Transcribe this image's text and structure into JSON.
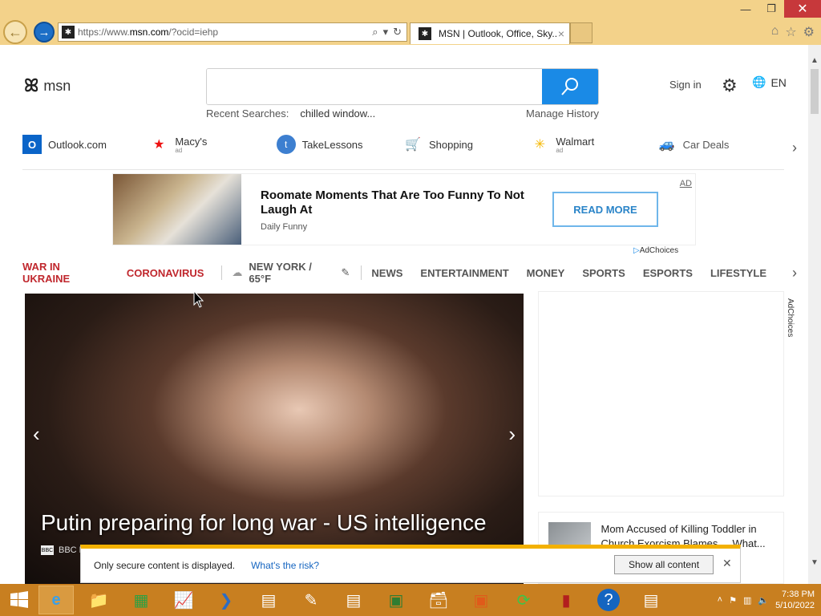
{
  "browser": {
    "url": "https://www.msn.com/?ocid=iehp",
    "url_prefix": "https://www.",
    "url_domain": "msn.com",
    "url_rest": "/?ocid=iehp",
    "tab_title": "MSN | Outlook, Office, Sky...",
    "tab_close": "×",
    "win_minimize": "—",
    "win_restore": "❐",
    "win_close": "✕"
  },
  "header": {
    "logo_text": "msn",
    "search_placeholder": "",
    "recent_label": "Recent Searches:",
    "recent_term": "chilled window...",
    "manage_history": "Manage History",
    "sign_in": "Sign in",
    "language": "EN"
  },
  "quicklinks": [
    {
      "label": "Outlook.com",
      "sub": "",
      "icon": "outlook-icon"
    },
    {
      "label": "Macy's",
      "sub": "ad",
      "icon": "macys-icon"
    },
    {
      "label": "TakeLessons",
      "sub": "",
      "icon": "takelessons-icon"
    },
    {
      "label": "Shopping",
      "sub": "",
      "icon": "cart-icon"
    },
    {
      "label": "Walmart",
      "sub": "ad",
      "icon": "walmart-icon"
    },
    {
      "label": "Car Deals",
      "sub": "",
      "icon": "car-icon"
    }
  ],
  "ad": {
    "headline": "Roomate Moments That Are Too Funny To Not Laugh At",
    "source": "Daily Funny",
    "cta": "READ MORE",
    "label": "AD",
    "adchoices": "AdChoices"
  },
  "categories": {
    "war": "WAR IN UKRAINE",
    "corona": "CORONAVIRUS",
    "weather": "NEW YORK / 65°F",
    "items": [
      "NEWS",
      "ENTERTAINMENT",
      "MONEY",
      "SPORTS",
      "ESPORTS",
      "LIFESTYLE"
    ]
  },
  "hero": {
    "title": "Putin preparing for long war - US intelligence",
    "source": "BBC N"
  },
  "sidebar": {
    "adchoices": "AdChoices",
    "card_title": "Mom Accused of Killing Toddler in Church Exorcism Blames ... What..."
  },
  "notification": {
    "message": "Only secure content is displayed.",
    "risk_link": "What's the risk?",
    "button": "Show all content"
  },
  "taskbar": {
    "time": "7:38 PM",
    "date": "5/10/2022"
  },
  "colors": {
    "chrome": "#f3d28a",
    "accent": "#1a8ae6",
    "red": "#c0272d",
    "taskbar": "#c87f20",
    "notif_border": "#f3b100"
  }
}
